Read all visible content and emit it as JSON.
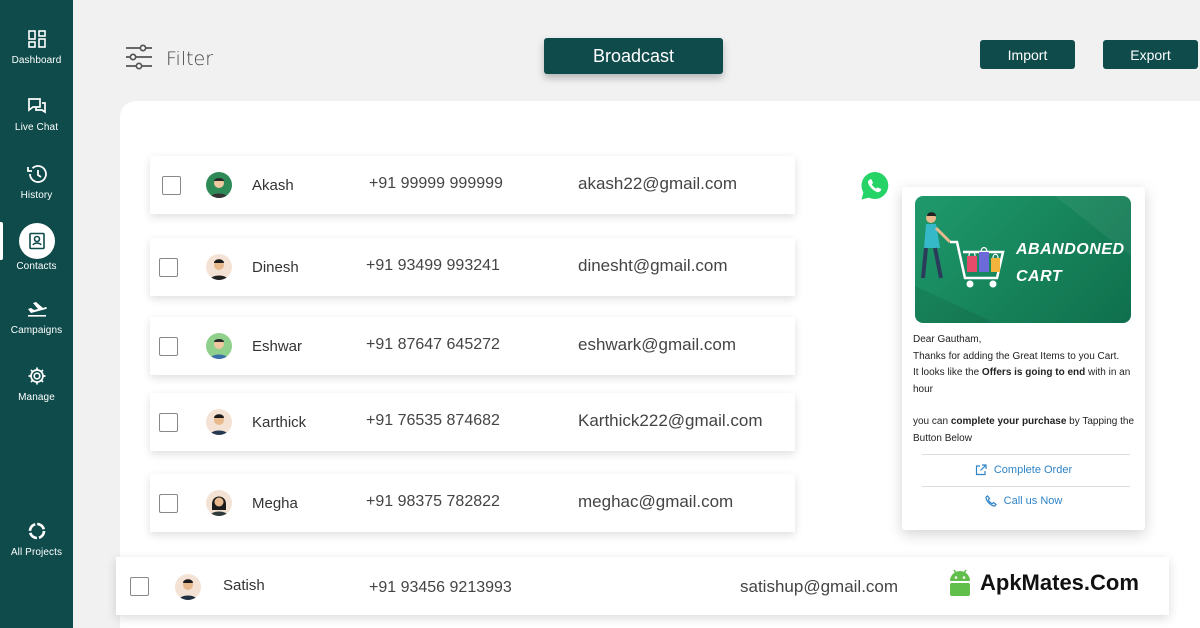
{
  "sidebar": {
    "items": [
      {
        "label": "Dashboard",
        "icon": "dashboard-icon"
      },
      {
        "label": "Live Chat",
        "icon": "chat-icon"
      },
      {
        "label": "History",
        "icon": "history-icon"
      },
      {
        "label": "Contacts",
        "icon": "contacts-icon",
        "active": true
      },
      {
        "label": "Campaigns",
        "icon": "plane-icon"
      },
      {
        "label": "Manage",
        "icon": "gear-icon"
      },
      {
        "label": "All Projects",
        "icon": "circle-icon"
      }
    ]
  },
  "toolbar": {
    "filter_label": "Filter",
    "broadcast_label": "Broadcast",
    "import_label": "Import",
    "export_label": "Export"
  },
  "contacts": [
    {
      "name": "Akash",
      "phone": "+91 99999 999999",
      "email": "akash22@gmail.com"
    },
    {
      "name": "Dinesh",
      "phone": "+91 93499 993241",
      "email": "dinesht@gmail.com"
    },
    {
      "name": "Eshwar",
      "phone": "+91 87647 645272",
      "email": "eshwark@gmail.com"
    },
    {
      "name": "Karthick",
      "phone": "+91 76535 874682",
      "email": "Karthick222@gmail.com"
    },
    {
      "name": "Megha",
      "phone": "+91 98375 782822",
      "email": "meghac@gmail.com"
    },
    {
      "name": "Satish",
      "phone": "+91 93456 9213993",
      "email": "satishup@gmail.com"
    }
  ],
  "message_card": {
    "banner_line1": "ABANDONED",
    "banner_line2": "CART",
    "greeting": "Dear Gautham,",
    "line1": "Thanks for adding the Great Items to you Cart.",
    "line2_pre": "It looks like the ",
    "line2_bold": "Offers is going to end",
    "line2_post": " with in an hour",
    "line3_pre": "you can ",
    "line3_bold": "complete your purchase",
    "line3_post": "  by Tapping the Button Below",
    "complete_order_label": "Complete Order",
    "call_label": "Call us Now"
  },
  "watermark": {
    "text": "ApkMates.Com"
  },
  "colors": {
    "brand": "#0f4b4b",
    "link": "#2f84c7",
    "whatsapp": "#25d366",
    "banner": "#1a8a60"
  }
}
